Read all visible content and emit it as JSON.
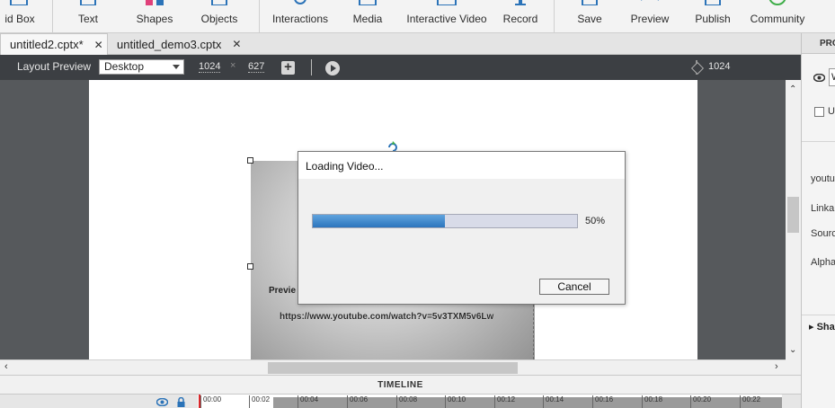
{
  "toolbar": {
    "items": [
      {
        "label": "id Box",
        "icon": "quiz-box-icon"
      },
      {
        "label": "Text",
        "icon": "text-icon"
      },
      {
        "label": "Shapes",
        "icon": "shapes-icon"
      },
      {
        "label": "Objects",
        "icon": "objects-icon"
      },
      {
        "label": "Interactions",
        "icon": "interactions-icon"
      },
      {
        "label": "Media",
        "icon": "media-icon"
      },
      {
        "label": "Interactive Video",
        "icon": "interactive-video-icon"
      },
      {
        "label": "Record",
        "icon": "record-icon"
      },
      {
        "label": "Save",
        "icon": "save-icon"
      },
      {
        "label": "Preview",
        "icon": "preview-icon"
      },
      {
        "label": "Publish",
        "icon": "publish-icon"
      },
      {
        "label": "Community",
        "icon": "community-icon"
      }
    ]
  },
  "tabs": [
    {
      "label": "untitled2.cptx*",
      "active": true
    },
    {
      "label": "untitled_demo3.cptx",
      "active": false
    }
  ],
  "layout_preview": {
    "label": "Layout Preview",
    "device": "Desktop",
    "width": "1024",
    "height": "627",
    "times": "×",
    "ruler_width": "1024"
  },
  "stage": {
    "preview_label": "Previe",
    "video_url": "https://www.youtube.com/watch?v=5v3TXM5v6Lw"
  },
  "timeline": {
    "title": "TIMELINE",
    "ticks": [
      "00:00",
      "00:02",
      "00:04",
      "00:06",
      "00:08",
      "00:10",
      "00:12",
      "00:14",
      "00:16",
      "00:18",
      "00:20",
      "00:22"
    ]
  },
  "properties": {
    "header": "PRO",
    "name_value": "W",
    "checkbox_label": "U",
    "labels": [
      "youtu",
      "Linka",
      "Sourc",
      "Alpha"
    ],
    "shadow_label": "Sha"
  },
  "dialog": {
    "title": "Loading Video...",
    "progress": 0.5,
    "progress_text": "50%",
    "cancel_label": "Cancel"
  },
  "colors": {
    "progress_fill": "#2c75bd",
    "playhead": "#d8282c",
    "stage_bg": "#56595c"
  }
}
